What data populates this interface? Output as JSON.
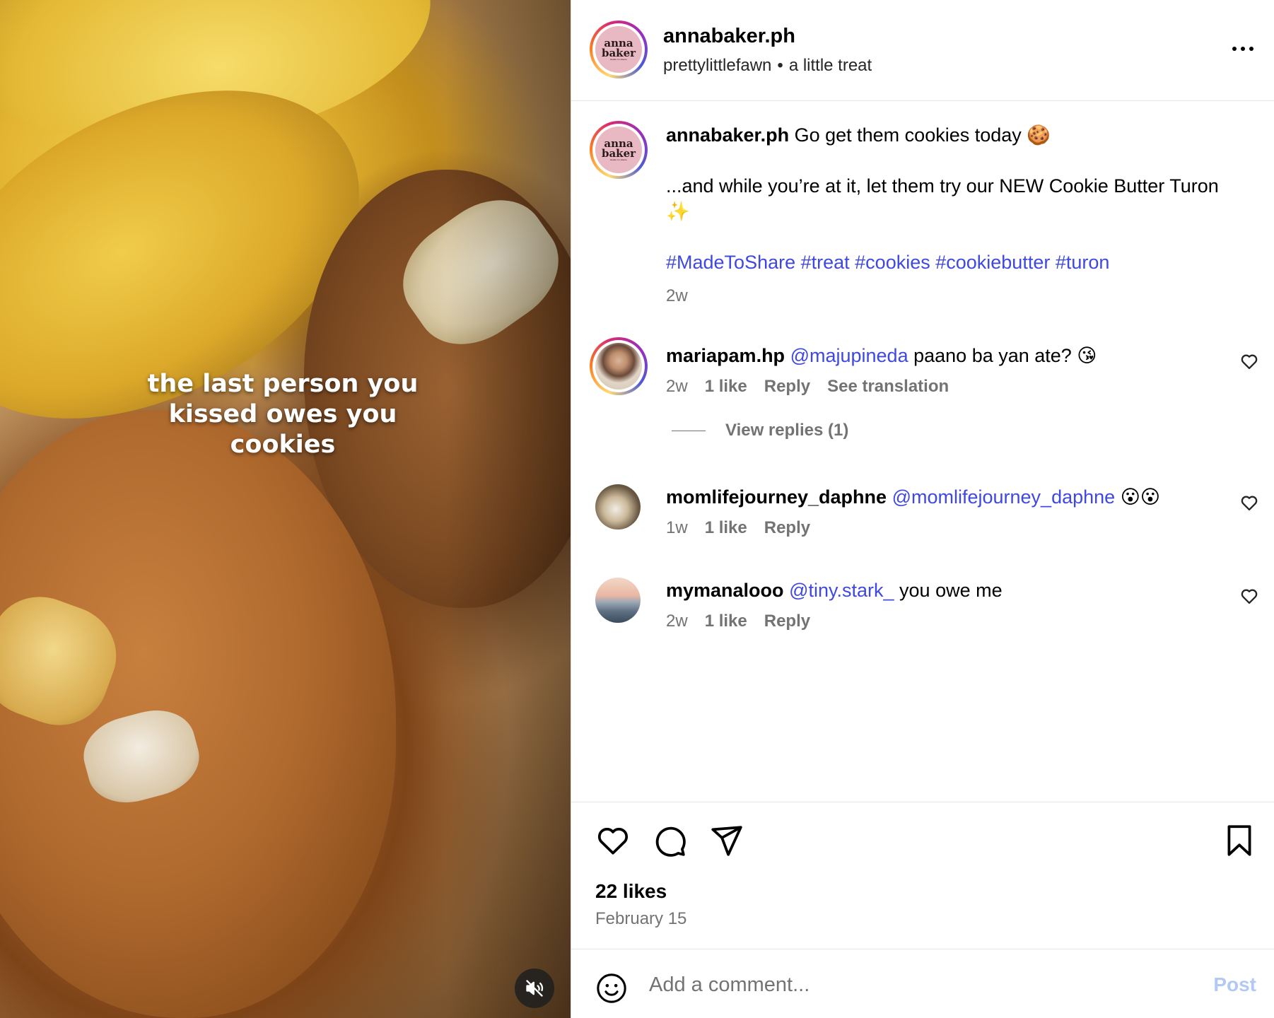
{
  "media": {
    "overlay_text": "the last person you kissed owes you cookies"
  },
  "header": {
    "username": "annabaker.ph",
    "collab": "prettylittlefawn",
    "audio": "a little treat",
    "logo_line1": "anna",
    "logo_line2": "baker",
    "logo_tagline": "made to share"
  },
  "caption": {
    "username": "annabaker.ph",
    "line1": "Go get them cookies today 🍪",
    "line2": "...and while you’re at it, let them try our NEW Cookie Butter Turon ✨",
    "hashtags": "#MadeToShare #treat #cookies #cookiebutter #turon",
    "time": "2w"
  },
  "comments": [
    {
      "username": "mariapam.hp",
      "mention": "@majupineda",
      "text": "paano ba yan ate? 😘",
      "time": "2w",
      "likes": "1 like",
      "reply": "Reply",
      "translate": "See translation",
      "view_replies": "View replies (1)"
    },
    {
      "username": "momlifejourney_daphne",
      "mention": "@momlifejourney_daphne",
      "text": "😮😮",
      "time": "1w",
      "likes": "1 like",
      "reply": "Reply"
    },
    {
      "username": "mymanalooo",
      "mention": "@tiny.stark_",
      "text": "you owe me",
      "time": "2w",
      "likes": "1 like",
      "reply": "Reply"
    }
  ],
  "actions": {
    "likes": "22 likes",
    "date": "February 15"
  },
  "comment_bar": {
    "placeholder": "Add a comment...",
    "post_label": "Post"
  },
  "icons": [
    "mute-icon",
    "more-options-icon",
    "heart-icon",
    "comment-icon",
    "share-icon",
    "bookmark-icon",
    "emoji-icon"
  ],
  "colors": {
    "link": "#3f48e0",
    "muted_text": "#737373",
    "post_button_disabled": "#b2c9f5"
  }
}
